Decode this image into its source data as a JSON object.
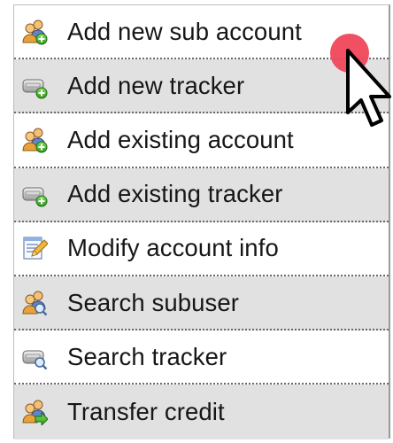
{
  "menu": {
    "items": [
      {
        "label": "Add new sub account",
        "icon": "users-add-icon"
      },
      {
        "label": "Add new tracker",
        "icon": "tracker-add-icon"
      },
      {
        "label": "Add existing account",
        "icon": "users-add-icon"
      },
      {
        "label": "Add existing tracker",
        "icon": "tracker-add-icon"
      },
      {
        "label": "Modify account info",
        "icon": "edit-form-icon"
      },
      {
        "label": "Search subuser",
        "icon": "users-search-icon"
      },
      {
        "label": "Search tracker",
        "icon": "tracker-search-icon"
      },
      {
        "label": "Transfer credit",
        "icon": "users-transfer-icon"
      }
    ]
  },
  "colors": {
    "row_alt": "#e1e1e1",
    "separator": "#6a6a6a",
    "cursor_highlight": "#f0475a"
  }
}
